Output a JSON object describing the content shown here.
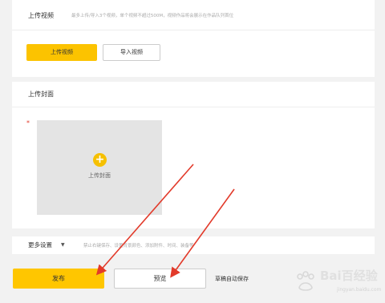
{
  "upload_video": {
    "title": "上传视频",
    "hint": "最多上传/导入3个视频，单个视频不超过500M，视频作品将会展示在作品队列首位",
    "upload_button": "上传视频",
    "import_button": "导入视频"
  },
  "upload_cover": {
    "title": "上传封面",
    "required_mark": "*",
    "box_label": "上传封面",
    "plus_glyph": "+"
  },
  "more_settings": {
    "label": "更多设置",
    "caret": "▼",
    "hint": "禁止右键保存、设置背景颜色、添加附件、时间、装备等"
  },
  "footer": {
    "publish_button": "发布",
    "preview_button": "预览",
    "autosave_text": "草稿自动保存"
  },
  "watermark": {
    "text": "Bai百经验",
    "url": "jingyan.baidu.com"
  },
  "colors": {
    "accent": "#ffc600",
    "annotation_arrow": "#e23a2a",
    "background": "#f2f2f2"
  }
}
